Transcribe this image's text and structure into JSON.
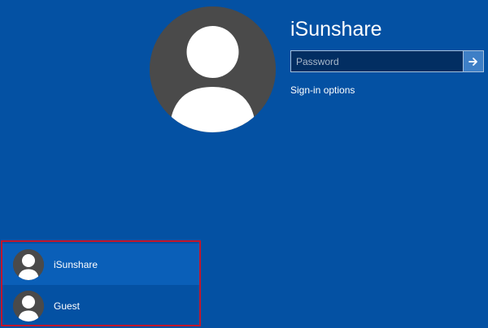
{
  "lock_screen": {
    "account_name": "iSunshare",
    "password_placeholder": "Password",
    "signin_options_label": "Sign-in options"
  },
  "user_switcher": {
    "accounts": [
      {
        "label": "iSunshare"
      },
      {
        "label": "Guest"
      }
    ]
  },
  "colors": {
    "background": "#0451a3",
    "selected_account": "#0a5fb8",
    "submit_button": "#3e7fc6",
    "avatar_circle": "#4a4a4a",
    "highlight_border": "#c3162b"
  },
  "icons": {
    "profile": "user-silhouette-icon",
    "submit": "arrow-right-icon"
  }
}
